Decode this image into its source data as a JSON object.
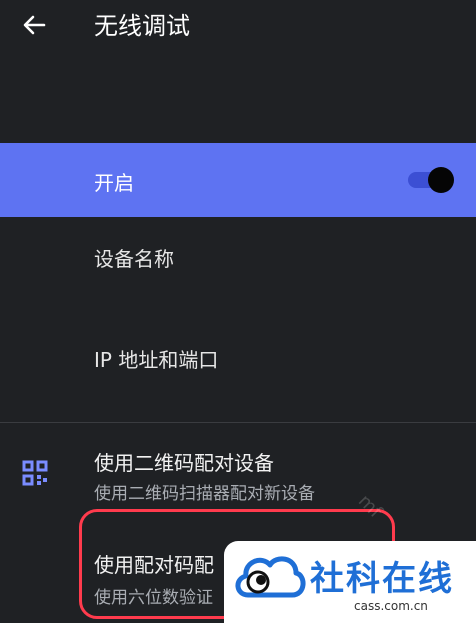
{
  "appbar": {
    "title": "无线调试",
    "back_icon": "arrow-left-icon"
  },
  "settings": {
    "enable": {
      "label": "开启",
      "toggle_on": true
    },
    "device_name": {
      "label": "设备名称"
    },
    "ip_port": {
      "label": "IP 地址和端口"
    }
  },
  "pairing": {
    "qr": {
      "title": "使用二维码配对设备",
      "subtitle": "使用二维码扫描器配对新设备",
      "icon": "qr-code-icon"
    },
    "code": {
      "title": "使用配对码配",
      "subtitle": "使用六位数验证"
    }
  },
  "watermark": {
    "overlay_text": "mf",
    "logo_text": "社科在线",
    "logo_url": "cass.com.cn"
  },
  "colors": {
    "background": "#1f2124",
    "accent": "#5e73f2",
    "highlight_border": "#ff3b4d",
    "logo_blue": "#1f6fd6"
  }
}
